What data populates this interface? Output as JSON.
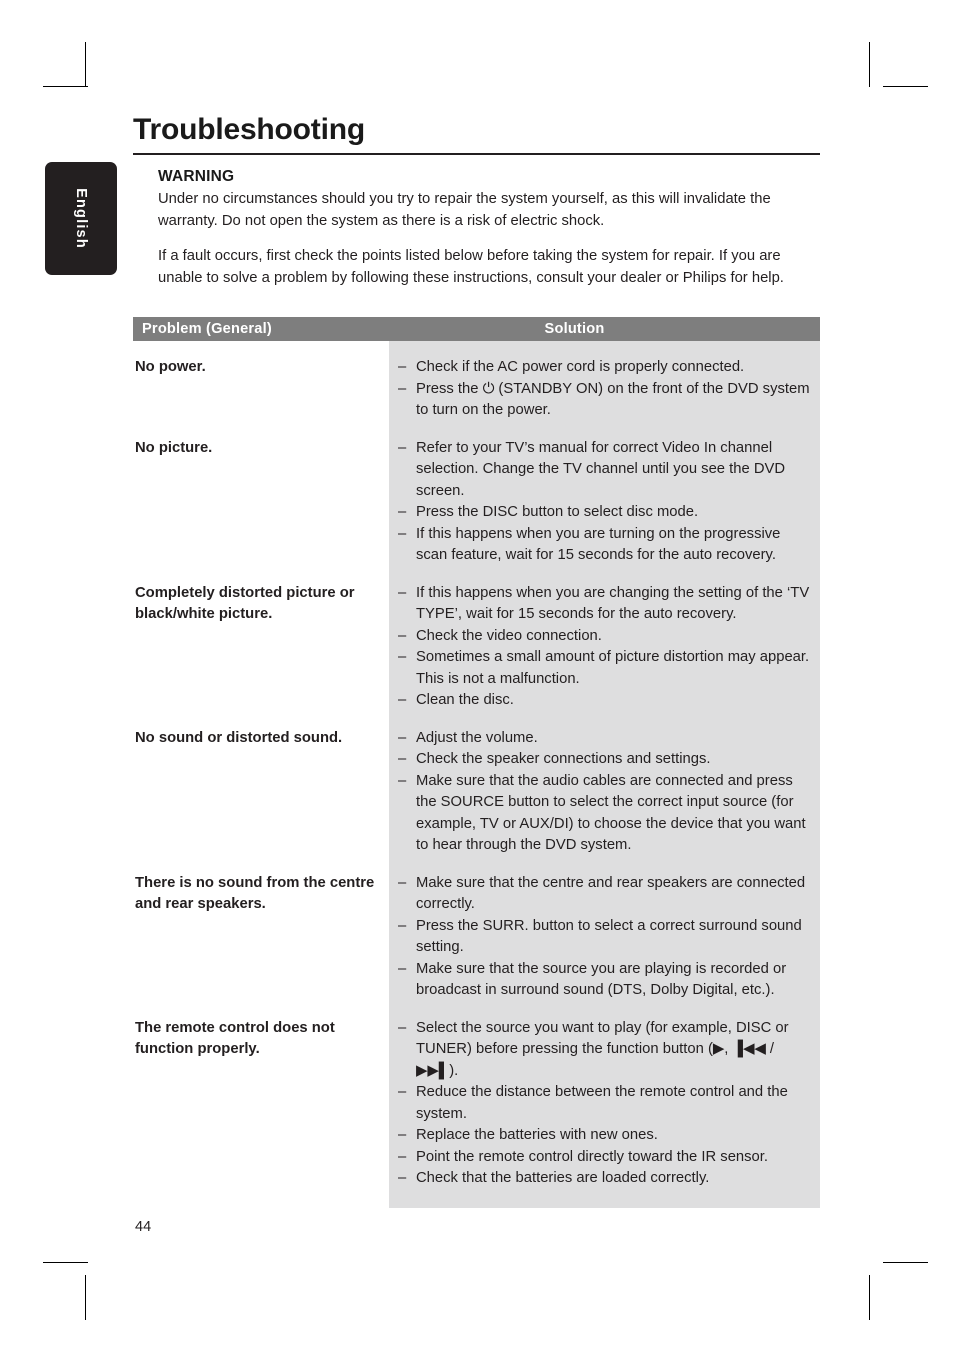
{
  "side_tab": {
    "label": "English"
  },
  "page": {
    "title": "Troubleshooting",
    "number": "44"
  },
  "intro": {
    "warning_heading": "WARNING",
    "warning_text": "Under no circumstances should you try to repair the system yourself, as this will invalidate the warranty. Do not open the system as there is a risk of electric shock.",
    "fault_text": "If a fault occurs, first check the points listed below before taking the system for repair. If you are unable to solve a problem by following these instructions, consult your dealer or Philips for help."
  },
  "table": {
    "headers": {
      "problem": "Problem (General)",
      "solution": "Solution"
    },
    "dash": "–",
    "rows": [
      {
        "problem": "No power.",
        "solutions": [
          "Check if the AC power cord is properly connected.",
          "Press the ⏻ (STANDBY ON) on the front of the DVD system to turn on the power."
        ]
      },
      {
        "problem": "No picture.",
        "solutions": [
          "Refer to your TV’s manual for correct Video In channel selection. Change the TV channel until you see the DVD screen.",
          "Press the DISC button to select disc mode.",
          "If this happens when you are turning on the progressive scan feature, wait for 15 seconds for the auto recovery."
        ]
      },
      {
        "problem": "Completely distorted picture or black/white picture.",
        "solutions": [
          "If this happens when you are changing the setting of the ‘TV TYPE’, wait for 15 seconds for the auto recovery.",
          "Check the video connection.",
          "Sometimes a small amount of picture distortion may appear. This is not a malfunction.",
          "Clean the disc."
        ]
      },
      {
        "problem": "No sound or distorted sound.",
        "solutions": [
          "Adjust the volume.",
          "Check the speaker connections and settings.",
          "Make sure that the audio cables are connected and press the SOURCE button to select the correct input source (for example, TV or AUX/DI) to choose the device that you want to hear through the DVD system."
        ]
      },
      {
        "problem": "There is no sound from the centre and rear speakers.",
        "solutions": [
          "Make sure that the centre and rear speakers are connected correctly.",
          "Press the SURR. button to select a correct surround sound setting.",
          "Make sure that the source you are playing is recorded or broadcast in surround sound (DTS, Dolby Digital, etc.)."
        ]
      },
      {
        "problem": "The remote control does not function properly.",
        "solutions": [
          "Select the source you want to play (for example, DISC or TUNER) before pressing the function button (▶, ▐◀◀ / ▶▶▌).",
          "Reduce the distance between the remote control and the system.",
          "Replace the batteries with new ones.",
          "Point the remote control directly toward the IR sensor.",
          "Check that the batteries are loaded correctly."
        ]
      }
    ]
  }
}
